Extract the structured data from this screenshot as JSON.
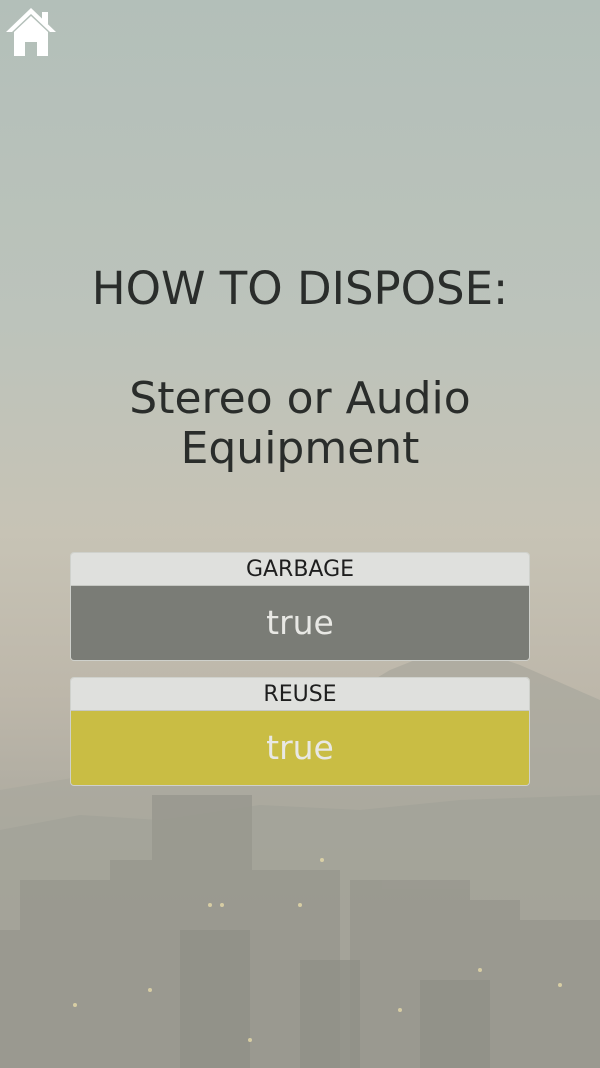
{
  "header": {
    "home_icon": "home-icon"
  },
  "title": "HOW TO DISPOSE:",
  "item_name": "Stereo or Audio Equipment",
  "categories": [
    {
      "label": "GARBAGE",
      "value": "true",
      "color": "#7a7c76"
    },
    {
      "label": "REUSE",
      "value": "true",
      "color": "#c9bd44"
    }
  ]
}
